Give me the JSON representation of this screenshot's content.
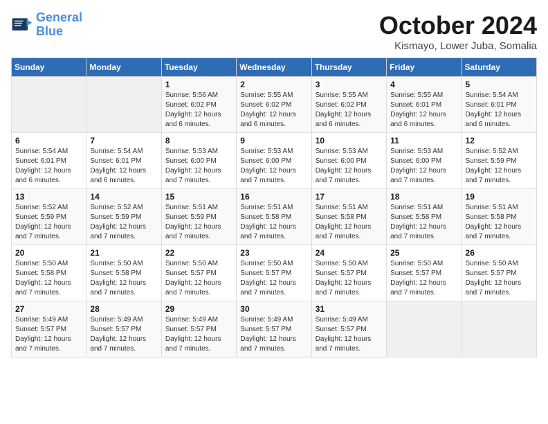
{
  "header": {
    "logo_line1": "General",
    "logo_line2": "Blue",
    "month": "October 2024",
    "location": "Kismayo, Lower Juba, Somalia"
  },
  "weekdays": [
    "Sunday",
    "Monday",
    "Tuesday",
    "Wednesday",
    "Thursday",
    "Friday",
    "Saturday"
  ],
  "weeks": [
    [
      {
        "day": "",
        "sunrise": "",
        "sunset": "",
        "daylight": ""
      },
      {
        "day": "",
        "sunrise": "",
        "sunset": "",
        "daylight": ""
      },
      {
        "day": "1",
        "sunrise": "Sunrise: 5:56 AM",
        "sunset": "Sunset: 6:02 PM",
        "daylight": "Daylight: 12 hours and 6 minutes."
      },
      {
        "day": "2",
        "sunrise": "Sunrise: 5:55 AM",
        "sunset": "Sunset: 6:02 PM",
        "daylight": "Daylight: 12 hours and 6 minutes."
      },
      {
        "day": "3",
        "sunrise": "Sunrise: 5:55 AM",
        "sunset": "Sunset: 6:02 PM",
        "daylight": "Daylight: 12 hours and 6 minutes."
      },
      {
        "day": "4",
        "sunrise": "Sunrise: 5:55 AM",
        "sunset": "Sunset: 6:01 PM",
        "daylight": "Daylight: 12 hours and 6 minutes."
      },
      {
        "day": "5",
        "sunrise": "Sunrise: 5:54 AM",
        "sunset": "Sunset: 6:01 PM",
        "daylight": "Daylight: 12 hours and 6 minutes."
      }
    ],
    [
      {
        "day": "6",
        "sunrise": "Sunrise: 5:54 AM",
        "sunset": "Sunset: 6:01 PM",
        "daylight": "Daylight: 12 hours and 6 minutes."
      },
      {
        "day": "7",
        "sunrise": "Sunrise: 5:54 AM",
        "sunset": "Sunset: 6:01 PM",
        "daylight": "Daylight: 12 hours and 6 minutes."
      },
      {
        "day": "8",
        "sunrise": "Sunrise: 5:53 AM",
        "sunset": "Sunset: 6:00 PM",
        "daylight": "Daylight: 12 hours and 7 minutes."
      },
      {
        "day": "9",
        "sunrise": "Sunrise: 5:53 AM",
        "sunset": "Sunset: 6:00 PM",
        "daylight": "Daylight: 12 hours and 7 minutes."
      },
      {
        "day": "10",
        "sunrise": "Sunrise: 5:53 AM",
        "sunset": "Sunset: 6:00 PM",
        "daylight": "Daylight: 12 hours and 7 minutes."
      },
      {
        "day": "11",
        "sunrise": "Sunrise: 5:53 AM",
        "sunset": "Sunset: 6:00 PM",
        "daylight": "Daylight: 12 hours and 7 minutes."
      },
      {
        "day": "12",
        "sunrise": "Sunrise: 5:52 AM",
        "sunset": "Sunset: 5:59 PM",
        "daylight": "Daylight: 12 hours and 7 minutes."
      }
    ],
    [
      {
        "day": "13",
        "sunrise": "Sunrise: 5:52 AM",
        "sunset": "Sunset: 5:59 PM",
        "daylight": "Daylight: 12 hours and 7 minutes."
      },
      {
        "day": "14",
        "sunrise": "Sunrise: 5:52 AM",
        "sunset": "Sunset: 5:59 PM",
        "daylight": "Daylight: 12 hours and 7 minutes."
      },
      {
        "day": "15",
        "sunrise": "Sunrise: 5:51 AM",
        "sunset": "Sunset: 5:59 PM",
        "daylight": "Daylight: 12 hours and 7 minutes."
      },
      {
        "day": "16",
        "sunrise": "Sunrise: 5:51 AM",
        "sunset": "Sunset: 5:58 PM",
        "daylight": "Daylight: 12 hours and 7 minutes."
      },
      {
        "day": "17",
        "sunrise": "Sunrise: 5:51 AM",
        "sunset": "Sunset: 5:58 PM",
        "daylight": "Daylight: 12 hours and 7 minutes."
      },
      {
        "day": "18",
        "sunrise": "Sunrise: 5:51 AM",
        "sunset": "Sunset: 5:58 PM",
        "daylight": "Daylight: 12 hours and 7 minutes."
      },
      {
        "day": "19",
        "sunrise": "Sunrise: 5:51 AM",
        "sunset": "Sunset: 5:58 PM",
        "daylight": "Daylight: 12 hours and 7 minutes."
      }
    ],
    [
      {
        "day": "20",
        "sunrise": "Sunrise: 5:50 AM",
        "sunset": "Sunset: 5:58 PM",
        "daylight": "Daylight: 12 hours and 7 minutes."
      },
      {
        "day": "21",
        "sunrise": "Sunrise: 5:50 AM",
        "sunset": "Sunset: 5:58 PM",
        "daylight": "Daylight: 12 hours and 7 minutes."
      },
      {
        "day": "22",
        "sunrise": "Sunrise: 5:50 AM",
        "sunset": "Sunset: 5:57 PM",
        "daylight": "Daylight: 12 hours and 7 minutes."
      },
      {
        "day": "23",
        "sunrise": "Sunrise: 5:50 AM",
        "sunset": "Sunset: 5:57 PM",
        "daylight": "Daylight: 12 hours and 7 minutes."
      },
      {
        "day": "24",
        "sunrise": "Sunrise: 5:50 AM",
        "sunset": "Sunset: 5:57 PM",
        "daylight": "Daylight: 12 hours and 7 minutes."
      },
      {
        "day": "25",
        "sunrise": "Sunrise: 5:50 AM",
        "sunset": "Sunset: 5:57 PM",
        "daylight": "Daylight: 12 hours and 7 minutes."
      },
      {
        "day": "26",
        "sunrise": "Sunrise: 5:50 AM",
        "sunset": "Sunset: 5:57 PM",
        "daylight": "Daylight: 12 hours and 7 minutes."
      }
    ],
    [
      {
        "day": "27",
        "sunrise": "Sunrise: 5:49 AM",
        "sunset": "Sunset: 5:57 PM",
        "daylight": "Daylight: 12 hours and 7 minutes."
      },
      {
        "day": "28",
        "sunrise": "Sunrise: 5:49 AM",
        "sunset": "Sunset: 5:57 PM",
        "daylight": "Daylight: 12 hours and 7 minutes."
      },
      {
        "day": "29",
        "sunrise": "Sunrise: 5:49 AM",
        "sunset": "Sunset: 5:57 PM",
        "daylight": "Daylight: 12 hours and 7 minutes."
      },
      {
        "day": "30",
        "sunrise": "Sunrise: 5:49 AM",
        "sunset": "Sunset: 5:57 PM",
        "daylight": "Daylight: 12 hours and 7 minutes."
      },
      {
        "day": "31",
        "sunrise": "Sunrise: 5:49 AM",
        "sunset": "Sunset: 5:57 PM",
        "daylight": "Daylight: 12 hours and 7 minutes."
      },
      {
        "day": "",
        "sunrise": "",
        "sunset": "",
        "daylight": ""
      },
      {
        "day": "",
        "sunrise": "",
        "sunset": "",
        "daylight": ""
      }
    ]
  ]
}
